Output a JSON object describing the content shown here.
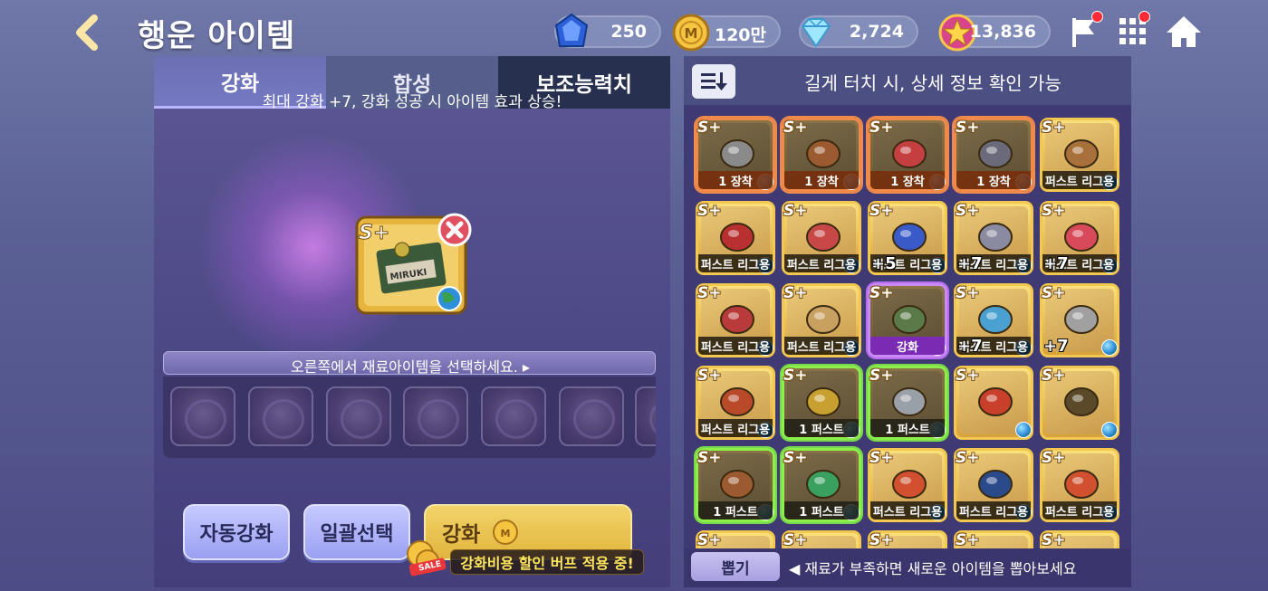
{
  "header": {
    "title": "행운 아이템",
    "currencies": [
      {
        "icon": "sapphire-icon",
        "value": "250"
      },
      {
        "icon": "gold-coin-icon",
        "value": "120만"
      },
      {
        "icon": "diamond-icon",
        "value": "2,724"
      },
      {
        "icon": "star-medal-icon",
        "value": "13,836"
      }
    ]
  },
  "tabs": [
    "강화",
    "합성",
    "보조능력치"
  ],
  "enhance": {
    "hint": "최대 강화 +7, 강화 성공 시 아이템 효과 상승!",
    "select_prompt": "오른쪽에서 재료아이템을 선택하세요.",
    "buttons": {
      "auto": "자동강화",
      "bulk": "일괄선택",
      "enhance": "강화"
    },
    "sale_badge": "SALE",
    "sale_text": "강화비용 할인 버프 적용 중!"
  },
  "inventory": {
    "title": "길게 터치 시, 상세 정보 확인 가능",
    "grade": "S+",
    "items": [
      {
        "label": "1 장착",
        "style": "equip"
      },
      {
        "label": "1 장착",
        "style": "equip"
      },
      {
        "label": "1 장착",
        "style": "equip"
      },
      {
        "label": "1 장착",
        "style": "equip"
      },
      {
        "label": "퍼스트 리그용",
        "style": "normal"
      },
      {
        "label": "퍼스트 리그용",
        "style": "normal"
      },
      {
        "label": "퍼스트 리그용",
        "style": "normal"
      },
      {
        "label": "퍼스트 리그용",
        "style": "normal",
        "plus": "+5"
      },
      {
        "label": "퍼스트 리그용",
        "style": "normal",
        "plus": "+7"
      },
      {
        "label": "퍼스트 리그용",
        "style": "normal",
        "plus": "+7"
      },
      {
        "label": "퍼스트 리그용",
        "style": "normal"
      },
      {
        "label": "퍼스트 리그용",
        "style": "normal"
      },
      {
        "label": "강화",
        "style": "selected"
      },
      {
        "label": "퍼스트 리그용",
        "style": "normal",
        "plus": "+7"
      },
      {
        "label": "",
        "style": "normal",
        "plus": "+7"
      },
      {
        "label": "퍼스트 리그용",
        "style": "normal"
      },
      {
        "label": "1 퍼스트",
        "style": "green"
      },
      {
        "label": "1 퍼스트",
        "style": "green"
      },
      {
        "label": "",
        "style": "normal"
      },
      {
        "label": "",
        "style": "normal"
      },
      {
        "label": "1 퍼스트",
        "style": "green"
      },
      {
        "label": "1 퍼스트",
        "style": "green"
      },
      {
        "label": "퍼스트 리그용",
        "style": "normal"
      },
      {
        "label": "퍼스트 리그용",
        "style": "normal"
      },
      {
        "label": "퍼스트 리그용",
        "style": "normal"
      }
    ],
    "draw_button": "뽑기",
    "footer_hint": "◀ 재료가 부족하면 새로운 아이템을 뽑아보세요"
  }
}
